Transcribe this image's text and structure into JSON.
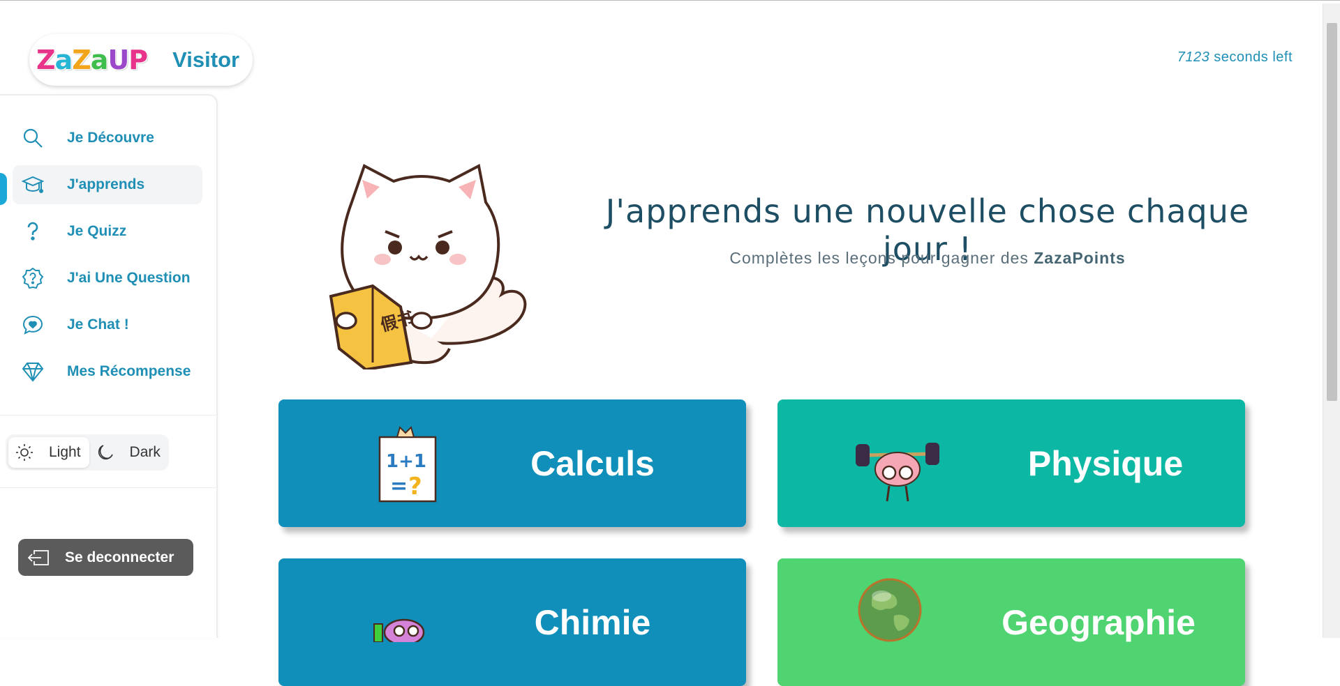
{
  "window": {
    "dot_colors": [
      "#e53935",
      "#fbc02d",
      "#43a047",
      "#4285f4"
    ]
  },
  "header": {
    "logo_text": "ZazaUP",
    "logo_colors": [
      "#e8338a",
      "#27b5d6",
      "#f2a51b",
      "#3fbd4d",
      "#9b48c9",
      "#e8338a"
    ],
    "user_label": "Visitor",
    "timer_value": "7123",
    "timer_suffix": "seconds left"
  },
  "sidebar": {
    "items": [
      {
        "label": "Je Découvre",
        "icon": "search-icon",
        "active": false
      },
      {
        "label": "J'apprends",
        "icon": "graduation-cap-icon",
        "active": true
      },
      {
        "label": "Je Quizz",
        "icon": "question-mark-icon",
        "active": false
      },
      {
        "label": "J'ai Une Question",
        "icon": "question-badge-icon",
        "active": false
      },
      {
        "label": "Je Chat !",
        "icon": "chat-heart-icon",
        "active": false
      },
      {
        "label": "Mes Récompense",
        "icon": "diamond-icon",
        "active": false
      }
    ],
    "theme": {
      "light_label": "Light",
      "dark_label": "Dark",
      "selected": "light"
    },
    "logout_label": "Se deconnecter"
  },
  "main": {
    "hero_title": "J'apprends une nouvelle chose chaque jour !",
    "hero_sub_prefix": "Complètes les leçons pour gagner des",
    "hero_sub_bold": "ZazaPoints",
    "cards": [
      {
        "label": "Calculs",
        "color": "#0f8fba",
        "icon": "calculation-board-icon"
      },
      {
        "label": "Physique",
        "color": "#0cb8a4",
        "icon": "brain-dumbbell-icon"
      },
      {
        "label": "Chimie",
        "color": "#0f8fba",
        "icon": "chemistry-flask-icon"
      },
      {
        "label": "Geographie",
        "color": "#4fd471",
        "icon": "globe-icon"
      }
    ]
  }
}
